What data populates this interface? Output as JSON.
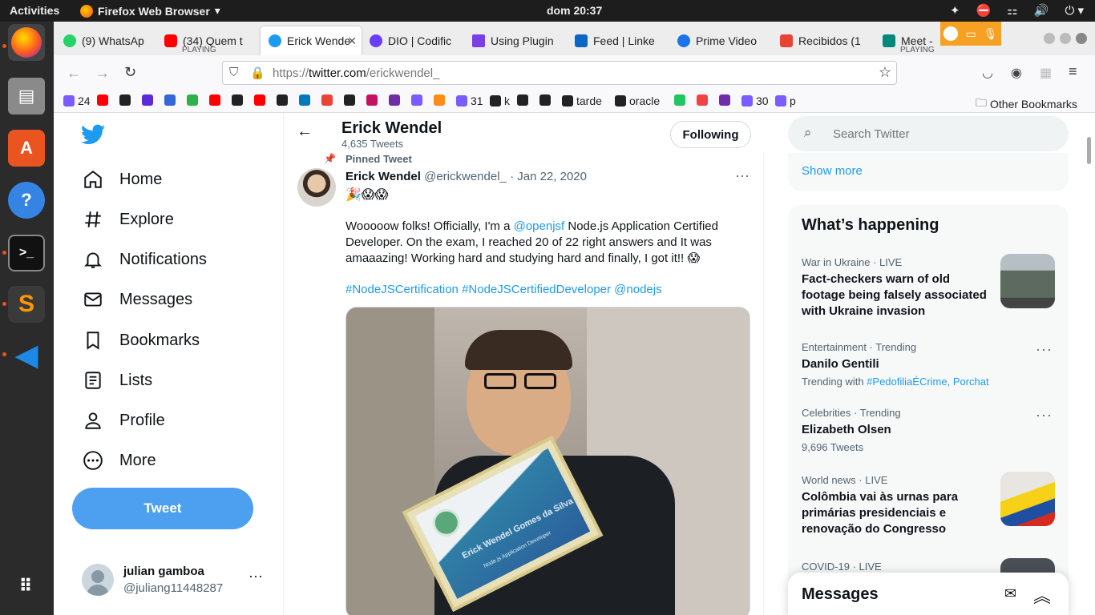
{
  "os": {
    "activities": "Activities",
    "app_name": "Firefox Web Browser",
    "clock": "dom 20:37"
  },
  "tabs": [
    {
      "label": "(9) WhatsAp",
      "color": "#25d366"
    },
    {
      "label": "(34) Quem t",
      "sub": "PLAYING",
      "color": "#ff0000"
    },
    {
      "label": "Erick Wende",
      "color": "#1d9bf0",
      "active": true
    },
    {
      "label": "DIO | Codific",
      "color": "#6c3cff"
    },
    {
      "label": "Using Plugin",
      "color": "#7b3fe4"
    },
    {
      "label": "Feed | Linke",
      "color": "#0a66c2"
    },
    {
      "label": "Prime Video",
      "color": "#1a73e8"
    },
    {
      "label": "Recibidos (1",
      "color": "#ea4335"
    },
    {
      "label": "Meet - ",
      "sub": "PLAYING",
      "color": "#00897b"
    }
  ],
  "url": {
    "prefix": "https://",
    "domain": "twitter.com",
    "path": "/erickwendel_"
  },
  "bookmarks": [
    {
      "label": "24"
    },
    {
      "label": ""
    },
    {
      "label": ""
    },
    {
      "label": ""
    },
    {
      "label": ""
    },
    {
      "label": ""
    },
    {
      "label": ""
    },
    {
      "label": ""
    },
    {
      "label": ""
    },
    {
      "label": ""
    },
    {
      "label": ""
    },
    {
      "label": ""
    },
    {
      "label": ""
    },
    {
      "label": ""
    },
    {
      "label": ""
    },
    {
      "label": ""
    },
    {
      "label": ""
    },
    {
      "label": "31"
    },
    {
      "label": "k"
    },
    {
      "label": ""
    },
    {
      "label": ""
    },
    {
      "label": "tarde"
    },
    {
      "label": "oracle"
    },
    {
      "label": ""
    },
    {
      "label": ""
    },
    {
      "label": ""
    },
    {
      "label": "30"
    },
    {
      "label": "p"
    }
  ],
  "other_bookmarks": "Other Bookmarks",
  "nav": {
    "home": "Home",
    "explore": "Explore",
    "notifications": "Notifications",
    "messages": "Messages",
    "bookmarks": "Bookmarks",
    "lists": "Lists",
    "profile": "Profile",
    "more": "More",
    "tweet": "Tweet"
  },
  "account": {
    "name": "julian gamboa",
    "handle": "@juliang11448287"
  },
  "profile_header": {
    "name": "Erick Wendel",
    "count": "4,635 Tweets",
    "follow": "Following"
  },
  "tweet": {
    "pinned": "Pinned Tweet",
    "name": "Erick Wendel",
    "handle": "@erickwendel_",
    "date": "· Jan 22, 2020",
    "emojis": "🎉😱😱",
    "text1": "Wooooow folks! Officially, I'm a ",
    "mention": "@openjsf",
    "text2": " Node.js Application Certified Developer. On the exam, I reached 20 of 22 right answers and It was amaaazing! Working hard and studying hard and finally, I got it!! 😱",
    "tags": "#NodeJSCertification #NodeJSCertifiedDeveloper @nodejs",
    "cert_name": "Erick Wendel Gomes da Silva",
    "cert_role": "Node.js Application Developer"
  },
  "search": {
    "placeholder": "Search Twitter"
  },
  "show_more": "Show more",
  "happening": {
    "title": "What’s happening",
    "items": [
      {
        "meta": "War in Ukraine · LIVE",
        "title": "Fact-checkers warn of old footage being falsely associated with Ukraine invasion"
      },
      {
        "meta": "Entertainment · Trending",
        "title": "Danilo Gentili",
        "sub": "Trending with ",
        "sub_links": "#PedofiliaÉCrime, Porchat"
      },
      {
        "meta": "Celebrities · Trending",
        "title": "Elizabeth Olsen",
        "sub": "9,696 Tweets"
      },
      {
        "meta": "World news · LIVE",
        "title": "Colômbia vai às urnas para primárias presidenciais e renovação do Congresso"
      },
      {
        "meta": "COVID-19 · LIVE"
      }
    ]
  },
  "messages_drawer": "Messages",
  "colors": {
    "twitter_blue": "#1d9bf0",
    "tweet_button": "#4d9ff0"
  }
}
